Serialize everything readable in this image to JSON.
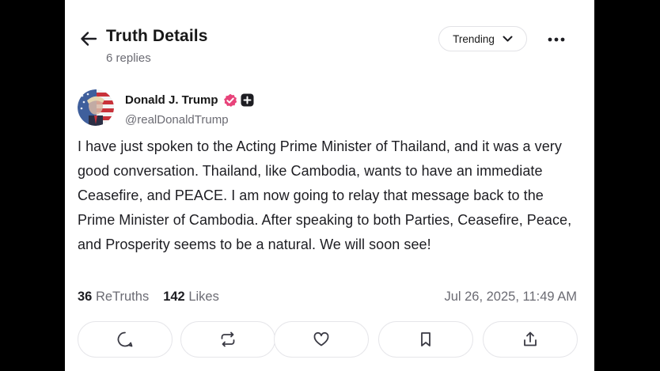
{
  "header": {
    "title": "Truth Details",
    "reply_count": "6 replies",
    "sort_label": "Trending"
  },
  "post": {
    "author_name": "Donald J. Trump",
    "author_handle": "@realDonaldTrump",
    "text": "I have just spoken to the Acting Prime Minister of Thailand, and it was a very good conversation. Thailand, like Cambodia, wants to have an immediate Ceasefire, and PEACE. I am now going to relay that message back to the Prime Minister of Cambodia. After speaking to both Parties, Ceasefire, Peace, and Prosperity seems to be a natural. We will soon see!",
    "retruths_count": "36",
    "retruths_label": "ReTruths",
    "likes_count": "142",
    "likes_label": "Likes",
    "timestamp": "Jul 26, 2025, 11:49 AM"
  },
  "icons": {
    "back": "arrow-left-icon",
    "sort": "chevron-down-icon",
    "more": "more-horizontal-icon",
    "verified": "verified-badge-icon",
    "plus": "plus-badge-icon",
    "reply": "chat-bubble-icon",
    "retruth": "repost-icon",
    "like": "heart-icon",
    "bookmark": "bookmark-icon",
    "share": "share-icon"
  },
  "colors": {
    "verified_badge": "#e8437a",
    "text_primary": "#171717",
    "text_secondary": "#6b6b73",
    "border": "#e6e6ea"
  }
}
